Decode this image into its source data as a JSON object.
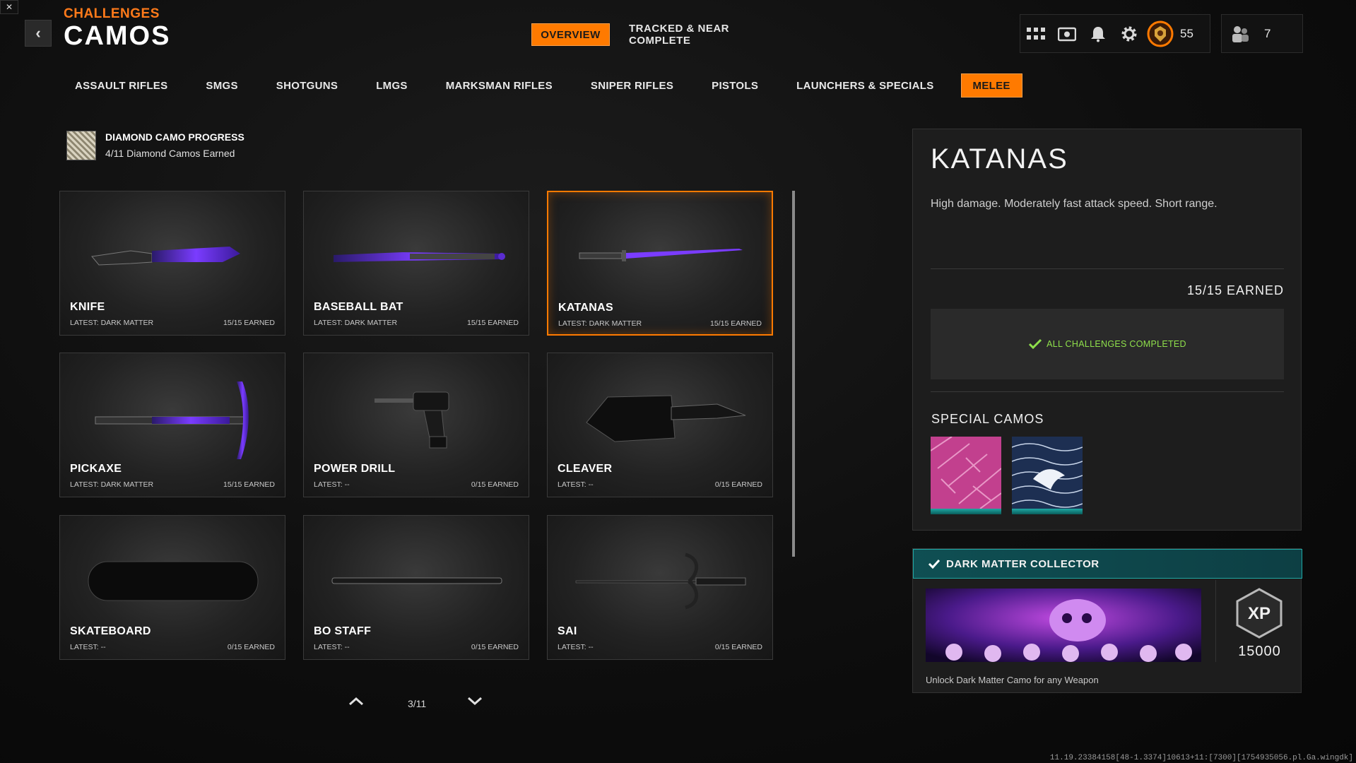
{
  "header": {
    "section": "CHALLENGES",
    "title": "CAMOS",
    "tabs": [
      {
        "label": "OVERVIEW",
        "active": true
      },
      {
        "label": "TRACKED & NEAR COMPLETE",
        "active": false
      }
    ],
    "level": "55",
    "party_count": "7",
    "icons": [
      "mute-icon",
      "back-icon",
      "grid-icon",
      "camera-icon",
      "bell-icon",
      "gear-icon",
      "rank-emblem-icon",
      "party-icon"
    ]
  },
  "categories": [
    {
      "label": "ASSAULT RIFLES",
      "active": false
    },
    {
      "label": "SMGS",
      "active": false
    },
    {
      "label": "SHOTGUNS",
      "active": false
    },
    {
      "label": "LMGS",
      "active": false
    },
    {
      "label": "MARKSMAN RIFLES",
      "active": false
    },
    {
      "label": "SNIPER RIFLES",
      "active": false
    },
    {
      "label": "PISTOLS",
      "active": false
    },
    {
      "label": "LAUNCHERS & SPECIALS",
      "active": false
    },
    {
      "label": "MELEE",
      "active": true
    }
  ],
  "diamond": {
    "title": "DIAMOND CAMO PROGRESS",
    "subtitle": "4/11 Diamond Camos Earned"
  },
  "weapons": [
    {
      "name": "KNIFE",
      "latest": "LATEST: DARK MATTER",
      "earned": "15/15 EARNED",
      "selected": false
    },
    {
      "name": "BASEBALL BAT",
      "latest": "LATEST: DARK MATTER",
      "earned": "15/15 EARNED",
      "selected": false
    },
    {
      "name": "KATANAS",
      "latest": "LATEST: DARK MATTER",
      "earned": "15/15 EARNED",
      "selected": true
    },
    {
      "name": "PICKAXE",
      "latest": "LATEST: DARK MATTER",
      "earned": "15/15 EARNED",
      "selected": false
    },
    {
      "name": "POWER DRILL",
      "latest": "LATEST: --",
      "earned": "0/15 EARNED",
      "selected": false
    },
    {
      "name": "CLEAVER",
      "latest": "LATEST: --",
      "earned": "0/15 EARNED",
      "selected": false
    },
    {
      "name": "SKATEBOARD",
      "latest": "LATEST: --",
      "earned": "0/15 EARNED",
      "selected": false
    },
    {
      "name": "BO STAFF",
      "latest": "LATEST: --",
      "earned": "0/15 EARNED",
      "selected": false
    },
    {
      "name": "SAI",
      "latest": "LATEST: --",
      "earned": "0/15 EARNED",
      "selected": false
    }
  ],
  "pager": {
    "label": "3/11"
  },
  "detail": {
    "title": "KATANAS",
    "description": "High damage.  Moderately fast attack speed. Short range.",
    "earned": "15/15 EARNED",
    "status": "ALL CHALLENGES COMPLETED",
    "special_title": "SPECIAL CAMOS"
  },
  "reward": {
    "title": "DARK MATTER COLLECTOR",
    "xp": "15000",
    "description": "Unlock Dark Matter Camo for any Weapon"
  },
  "footer": "11.19.23384158[48-1.3374]10613+11:[7300][1754935056.pl.Ga.wingdk]",
  "colors": {
    "accent": "#ff7a00",
    "complete": "#8fe04b",
    "teal": "#1fa8a4",
    "camo_purple": "#6a2cff"
  }
}
